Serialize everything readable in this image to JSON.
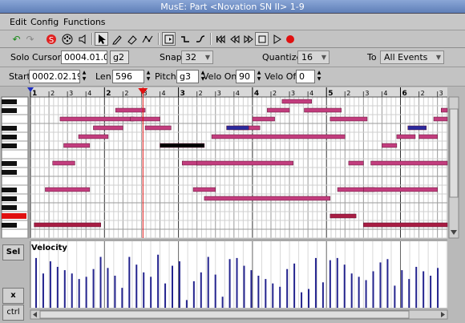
{
  "window": {
    "title": "MusE: Part <Novation SN II> 1-9"
  },
  "menu": [
    {
      "label": "Edit",
      "x": 12
    },
    {
      "label": "Config",
      "x": 38
    },
    {
      "label": "Functions",
      "x": 79
    }
  ],
  "info": {
    "solo_cursor_label": "Solo Cursor",
    "cursor_position": "0004.01.000",
    "cursor_note": "g2",
    "snap_label": "Snap",
    "snap_value": "32",
    "quantize_label": "Quantize",
    "quantize_value": "16",
    "to_label": "To",
    "to_value": "All Events",
    "start_label": "Start",
    "start_value": "0002.02.192",
    "len_label": "Len",
    "len_value": "596",
    "pitch_label": "Pitch",
    "pitch_value": "g3",
    "velo_on_label": "Velo On",
    "velo_on_value": "90",
    "velo_off_label": "Velo Off",
    "velo_off_value": "0"
  },
  "ruler": {
    "bars": [
      "1",
      "2",
      "3",
      "4",
      "5",
      "6"
    ],
    "beats": [
      "2",
      "3",
      "4"
    ]
  },
  "controller": {
    "label": "Velocity",
    "sel_label": "Sel",
    "x_label": "x",
    "ctrl_label": "ctrl"
  },
  "colors": {
    "note": "#c23d7e",
    "note_selected": "#000000",
    "note_low": "#a81d43",
    "note_blue": "#2a2a9c",
    "velocity_bar": "#24248e",
    "cursor": "#e01010",
    "grid": "#cfcfcf"
  },
  "notes": [
    {
      "start": 0.4,
      "len": 1.0,
      "row": 2
    },
    {
      "start": 1.15,
      "len": 0.4,
      "row": 1
    },
    {
      "start": 1.35,
      "len": 0.4,
      "row": 2
    },
    {
      "start": 0.85,
      "len": 0.4,
      "row": 3
    },
    {
      "start": 0.65,
      "len": 0.4,
      "row": 4
    },
    {
      "start": 0.45,
      "len": 0.35,
      "row": 5
    },
    {
      "start": 1.55,
      "len": 0.35,
      "row": 3
    },
    {
      "start": 0.3,
      "len": 0.3,
      "row": 7
    },
    {
      "start": 0.2,
      "len": 0.6,
      "row": 10
    },
    {
      "start": 0.05,
      "len": 0.9,
      "row": 14
    },
    {
      "start": 1.75,
      "len": 0.6,
      "row": 5,
      "selected": true
    },
    {
      "start": 2.05,
      "len": 0.4,
      "row": 7
    },
    {
      "start": 2.2,
      "len": 0.3,
      "row": 10
    },
    {
      "start": 2.35,
      "len": 1.7,
      "row": 11
    },
    {
      "start": 2.25,
      "len": 1.3,
      "row": 7
    },
    {
      "start": 2.45,
      "len": 1.8,
      "row": 4
    },
    {
      "start": 2.75,
      "len": 0.35,
      "row": 3
    },
    {
      "start": 2.65,
      "len": 0.3,
      "row": 3,
      "blue": true
    },
    {
      "start": 3.0,
      "len": 0.3,
      "row": 2
    },
    {
      "start": 3.2,
      "len": 0.3,
      "row": 1
    },
    {
      "start": 3.4,
      "len": 0.4,
      "row": 0
    },
    {
      "start": 3.7,
      "len": 0.5,
      "row": 1
    },
    {
      "start": 4.05,
      "len": 0.5,
      "row": 2
    },
    {
      "start": 4.15,
      "len": 0.5,
      "row": 10
    },
    {
      "start": 4.05,
      "len": 0.35,
      "row": 13
    },
    {
      "start": 4.5,
      "len": 1.0,
      "row": 10
    },
    {
      "start": 4.3,
      "len": 0.2,
      "row": 7
    },
    {
      "start": 4.6,
      "len": 1.2,
      "row": 7
    },
    {
      "start": 4.75,
      "len": 0.2,
      "row": 5
    },
    {
      "start": 4.95,
      "len": 0.25,
      "row": 4
    },
    {
      "start": 5.1,
      "len": 0.25,
      "row": 3,
      "blue": true
    },
    {
      "start": 5.25,
      "len": 0.25,
      "row": 4
    },
    {
      "start": 5.45,
      "len": 0.3,
      "row": 2
    },
    {
      "start": 5.55,
      "len": 0.2,
      "row": 1
    },
    {
      "start": 4.5,
      "len": 1.4,
      "row": 14
    }
  ],
  "velocities": [
    0.9,
    0.62,
    0.84,
    0.74,
    0.68,
    0.62,
    0.52,
    0.56,
    0.7,
    0.92,
    0.72,
    0.58,
    0.36,
    0.92,
    0.78,
    0.64,
    0.56,
    0.96,
    0.44,
    0.76,
    0.84,
    0.14,
    0.48,
    0.64,
    0.92,
    0.6,
    0.2,
    0.88,
    0.9,
    0.76,
    0.68,
    0.58,
    0.52,
    0.44,
    0.38,
    0.7,
    0.8,
    0.28,
    0.34,
    0.9,
    0.46,
    0.86,
    0.9,
    0.78,
    0.62,
    0.56,
    0.5,
    0.66,
    0.82,
    0.88,
    0.4,
    0.68,
    0.52,
    0.74,
    0.66,
    0.58,
    0.72
  ]
}
